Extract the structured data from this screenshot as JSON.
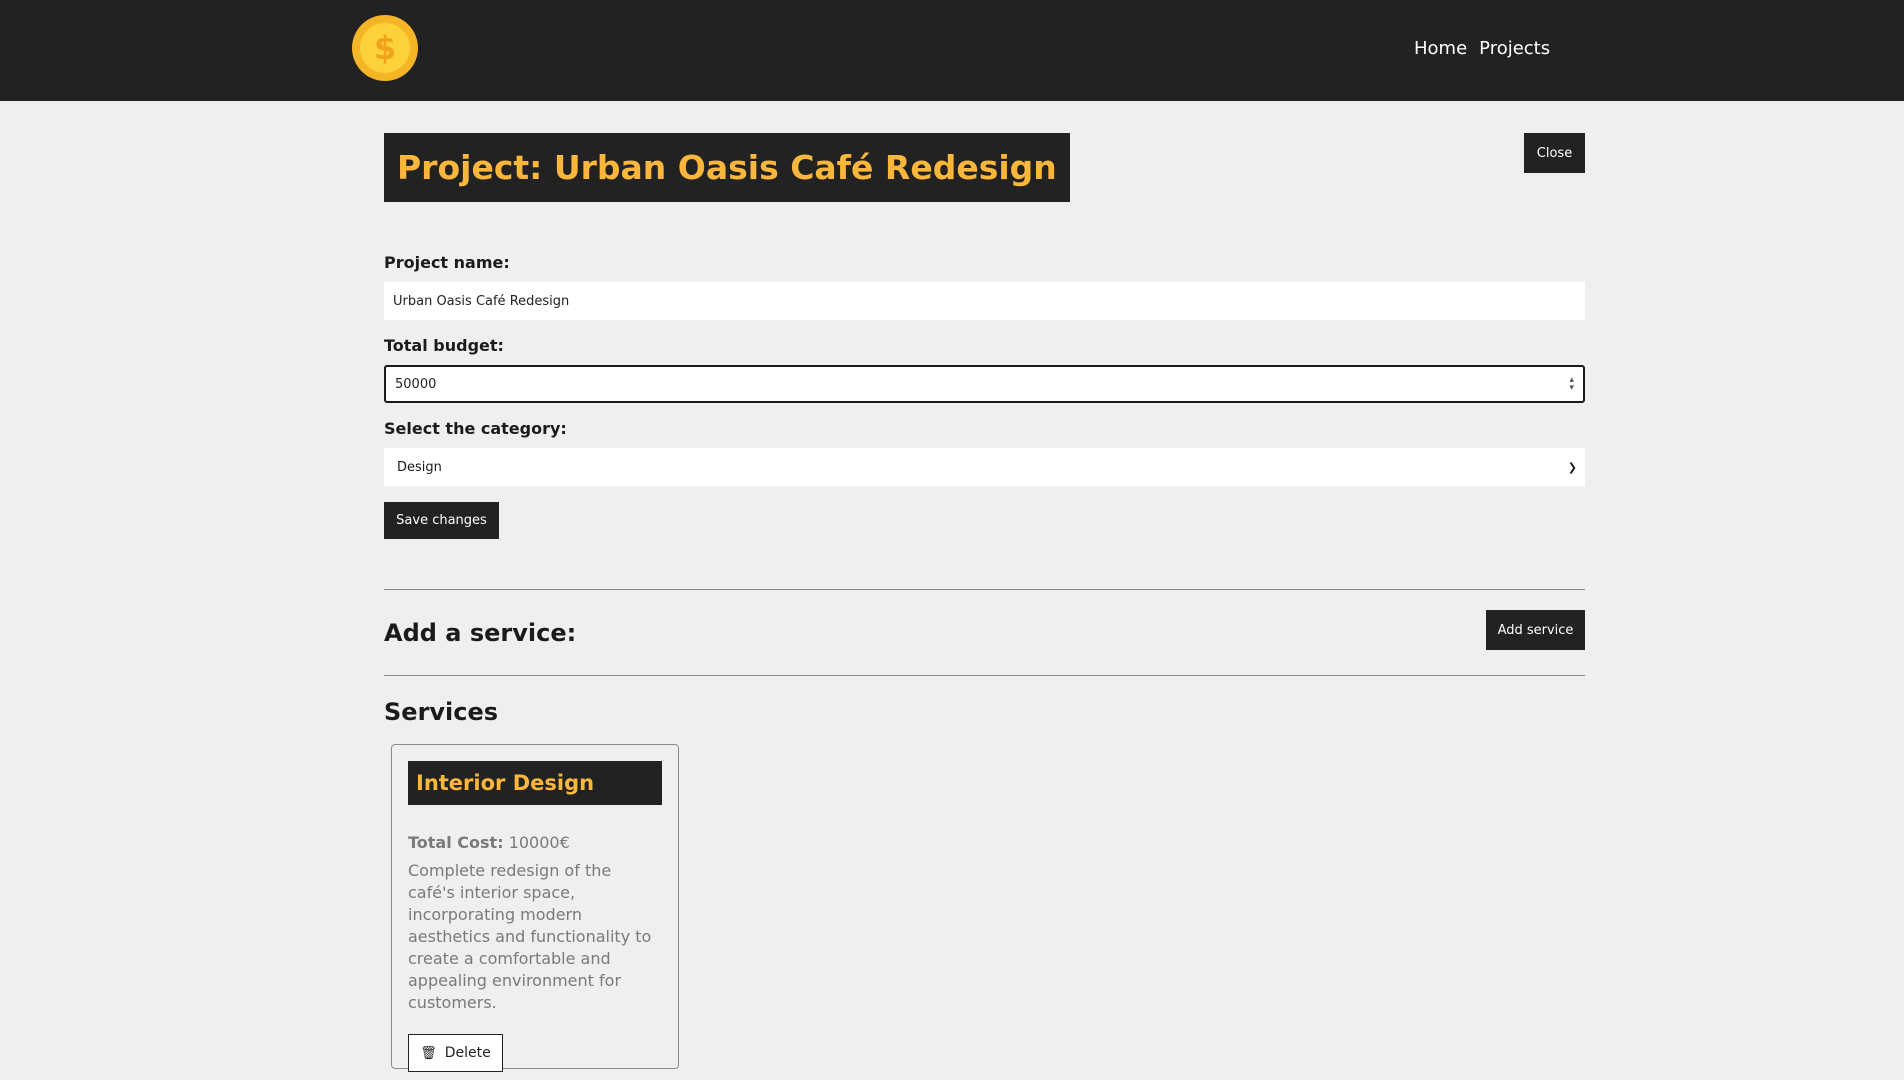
{
  "navbar": {
    "logo_glyph": "$",
    "links": [
      {
        "label": "Home"
      },
      {
        "label": "Projects"
      }
    ]
  },
  "project": {
    "title": "Project: Urban Oasis Café Redesign",
    "close_label": "Close"
  },
  "form": {
    "name_label": "Project name:",
    "name_value": "Urban Oasis Café Redesign",
    "budget_label": "Total budget:",
    "budget_value": "50000",
    "category_label": "Select the category:",
    "category_value": "Design",
    "save_label": "Save changes"
  },
  "add_service": {
    "heading": "Add a service:",
    "button_label": "Add service"
  },
  "services": {
    "heading": "Services",
    "items": [
      {
        "title": "Interior Design",
        "cost_label": "Total Cost:",
        "cost_value": "10000€",
        "description": "Complete redesign of the café's interior space, incorporating modern aesthetics and functionality to create a comfortable and appealing environment for customers.",
        "delete_label": "Delete"
      }
    ]
  },
  "icons": {
    "logo": "coin-icon",
    "trash": "trash-icon",
    "select": "chevron-down-icon",
    "spinner": "spinner-icon"
  },
  "colors": {
    "navbar_bg": "#222222",
    "accent": "#fbb73b",
    "page_bg": "#efefef"
  }
}
